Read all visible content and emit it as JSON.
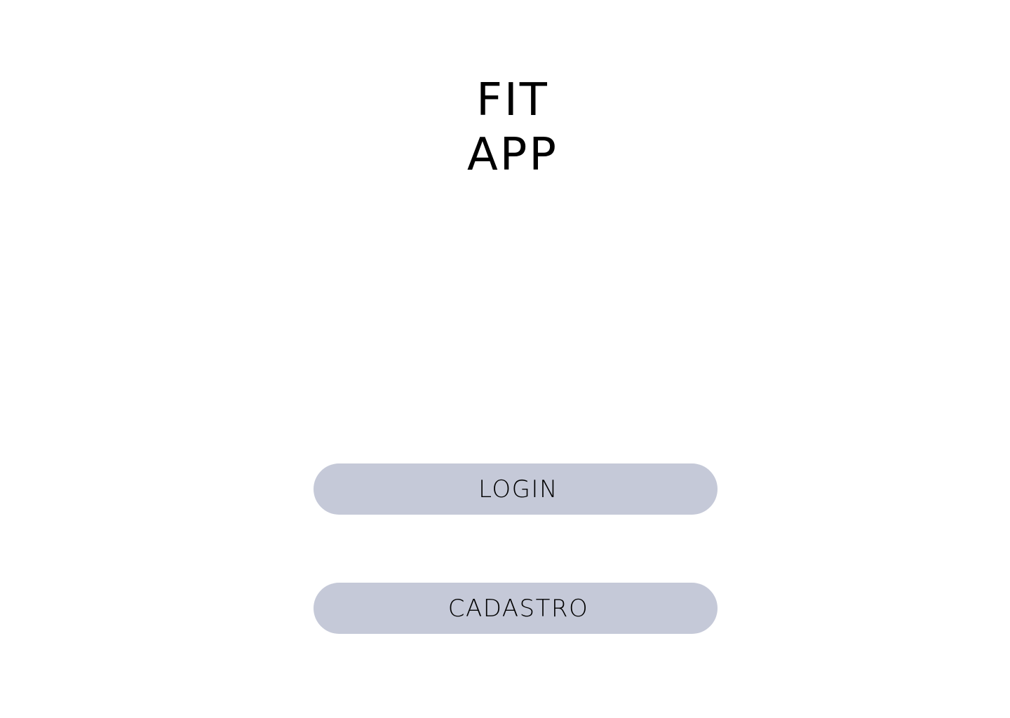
{
  "app": {
    "title_line_1": "FIT",
    "title_line_2": "APP"
  },
  "actions": {
    "login_label": "LOGIN",
    "signup_label": "CADASTRO"
  },
  "colors": {
    "background": "#ffffff",
    "button_fill": "#c5c9d8",
    "text": "#000000"
  }
}
